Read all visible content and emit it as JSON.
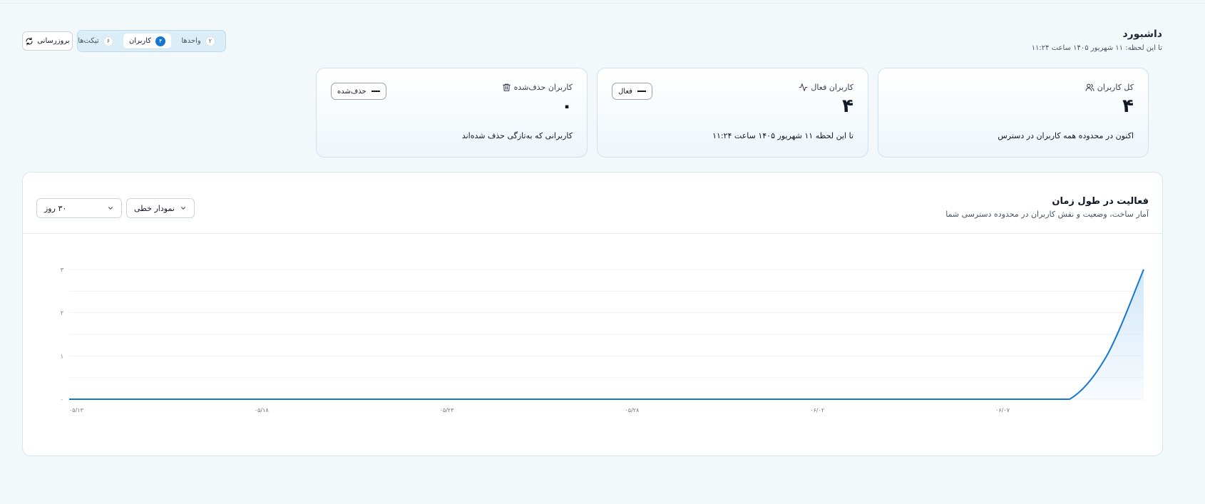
{
  "header": {
    "title": "داشبورد",
    "subtitle": "تا این لحظه: ۱۱ شهریور ۱۴۰۵ ساعت ۱۱:۲۴"
  },
  "toolbar": {
    "refresh_label": "بروزرسانی",
    "tabs": [
      {
        "label": "واحدها",
        "count": "۲"
      },
      {
        "label": "کاربران",
        "count": "۴"
      },
      {
        "label": "تیکت‌ها",
        "count": "۶"
      }
    ]
  },
  "cards": [
    {
      "label": "کل کاربران",
      "value": "۴",
      "desc": "اکنون در محدوده همه کاربران در دسترس"
    },
    {
      "label": "کاربران فعال",
      "value": "۴",
      "desc": "تا این لحظه ۱۱ شهریور ۱۴۰۵ ساعت ۱۱:۲۴",
      "badge": "فعال"
    },
    {
      "label": "کاربران حذف‌شده",
      "value": "۰",
      "desc": "کاربرانی که به‌تازگی حذف شده‌اند",
      "badge": "حذف‌شده"
    }
  ],
  "chart_section": {
    "title": "فعالیت در طول زمان",
    "subtitle": "آمار ساخت، وضعیت و نقش کاربران در محدوده دسترسی شما",
    "chart_type_select": "نمودار خطی",
    "range_select": "۳۰ روز"
  },
  "colors": {
    "accent": "#1677d2",
    "line": "#1677d2",
    "area": "#cfe6f7"
  },
  "chart_data": {
    "type": "area",
    "x_tick_labels": [
      "۰۵/۱۳",
      "۰۵/۱۸",
      "۰۵/۲۳",
      "۰۵/۲۸",
      "۰۶/۰۲",
      "۰۶/۰۷"
    ],
    "y_tick_labels": [
      "۰",
      "۱",
      "۲",
      "۳"
    ],
    "ylim": [
      0,
      3
    ],
    "grid": true,
    "x": [
      "۰۵/۱۳",
      "۰۵/۱۴",
      "۰۵/۱۵",
      "۰۵/۱۶",
      "۰۵/۱۷",
      "۰۵/۱۸",
      "۰۵/۱۹",
      "۰۵/۲۰",
      "۰۵/۲۱",
      "۰۵/۲۲",
      "۰۵/۲۳",
      "۰۵/۲۴",
      "۰۵/۲۵",
      "۰۵/۲۶",
      "۰۵/۲۷",
      "۰۵/۲۸",
      "۰۵/۲۹",
      "۰۵/۳۰",
      "۰۵/۳۱",
      "۰۶/۰۱",
      "۰۶/۰۲",
      "۰۶/۰۳",
      "۰۶/۰۴",
      "۰۶/۰۵",
      "۰۶/۰۶",
      "۰۶/۰۷",
      "۰۶/۰۸",
      "۰۶/۰۹",
      "۰۶/۱۰",
      "۰۶/۱۱"
    ],
    "series": [
      {
        "values": [
          0,
          0,
          0,
          0,
          0,
          0,
          0,
          0,
          0,
          0,
          0,
          0,
          0,
          0,
          0,
          0,
          0,
          0,
          0,
          0,
          0,
          0,
          0,
          0,
          0,
          0,
          0,
          0,
          1,
          3
        ]
      }
    ]
  }
}
